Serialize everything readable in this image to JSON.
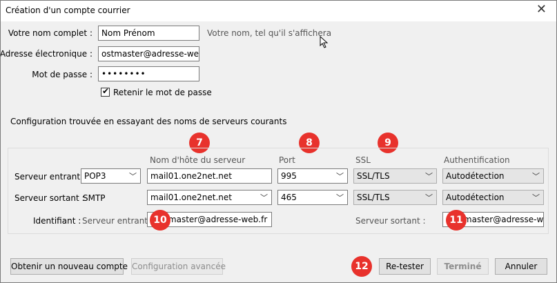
{
  "window": {
    "title": "Création d'un compte courrier"
  },
  "account": {
    "name_label": "Votre nom complet :",
    "name_value": "Nom Prénom",
    "name_hint": "Votre nom, tel qu'il s'affichera",
    "email_label": "Adresse électronique :",
    "email_value": "ostmaster@adresse-web.fr",
    "password_label": "Mot de passe :",
    "password_value": "••••••••",
    "remember_label": "Retenir le mot de passe",
    "remember_checked": true
  },
  "config_message": "Configuration trouvée en essayant des noms de serveurs courants",
  "server_table": {
    "headers": {
      "hostname": "Nom d'hôte du serveur",
      "port": "Port",
      "ssl": "SSL",
      "auth": "Authentification"
    },
    "incoming": {
      "label": "Serveur entrant :",
      "protocol": "POP3",
      "hostname": "mail01.one2net.net",
      "port": "995",
      "ssl": "SSL/TLS",
      "auth": "Autodétection"
    },
    "outgoing": {
      "label": "Serveur sortant :",
      "protocol": "SMTP",
      "hostname": "mail01.one2net.net",
      "port": "465",
      "ssl": "SSL/TLS",
      "auth": "Autodétection"
    },
    "identifier": {
      "label": "Identifiant :",
      "incoming_label": "Serveur entrant :",
      "incoming_value": "postmaster@adresse-web.fr",
      "outgoing_label": "Serveur sortant :",
      "outgoing_value": "postmaster@adresse-web.fr"
    }
  },
  "badges": [
    "7",
    "8",
    "9",
    "10",
    "11",
    "12"
  ],
  "buttons": {
    "new_account": "Obtenir un nouveau compte",
    "advanced": "Configuration avancée",
    "retest": "Re-tester",
    "done": "Terminé",
    "cancel": "Annuler"
  },
  "icons": {
    "close": "close-icon",
    "chevron": "chevron-down-icon",
    "cursor": "mouse-pointer-icon"
  },
  "colors": {
    "badge": "#e8322c"
  }
}
